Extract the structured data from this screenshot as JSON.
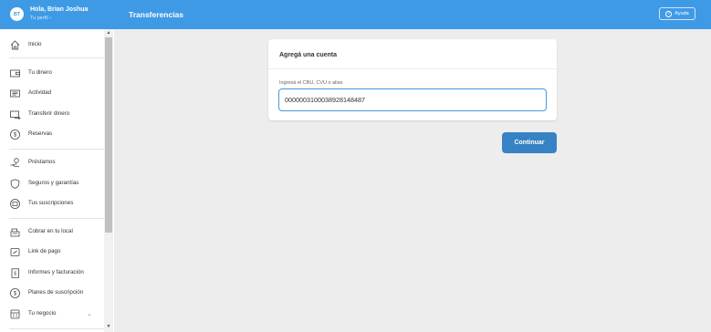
{
  "header": {
    "avatar_initials": "BT",
    "greeting": "Hola, Brian Joshua",
    "profile_link": "Tu perfil",
    "title": "Transferencias",
    "help_label": "Ayuda"
  },
  "sidebar": {
    "items": [
      {
        "label": "Inicio",
        "icon": "home-icon"
      },
      {
        "label": "Tu dinero",
        "icon": "wallet-icon"
      },
      {
        "label": "Actividad",
        "icon": "activity-icon"
      },
      {
        "label": "Transferir dinero",
        "icon": "transfer-icon"
      },
      {
        "label": "Reservas",
        "icon": "savings-icon"
      },
      {
        "label": "Préstamos",
        "icon": "loans-icon"
      },
      {
        "label": "Seguros y garantías",
        "icon": "shield-icon"
      },
      {
        "label": "Tus suscripciones",
        "icon": "subscriptions-icon"
      },
      {
        "label": "Cobrar en tu local",
        "icon": "register-icon"
      },
      {
        "label": "Link de pago",
        "icon": "link-icon"
      },
      {
        "label": "Informes y facturación",
        "icon": "report-icon"
      },
      {
        "label": "Planes de suscripción",
        "icon": "plans-icon"
      },
      {
        "label": "Tu negocio",
        "icon": "business-icon"
      }
    ]
  },
  "form": {
    "title": "Agregá una cuenta",
    "field_label": "Ingresá el CBU, CVU o alias",
    "field_value": "0000003100038928148487",
    "submit_label": "Continuar"
  },
  "colors": {
    "header_bg": "#3f9ae6",
    "button_bg": "#3782c4",
    "input_border": "#3f9ae6",
    "page_bg": "#ededed"
  }
}
